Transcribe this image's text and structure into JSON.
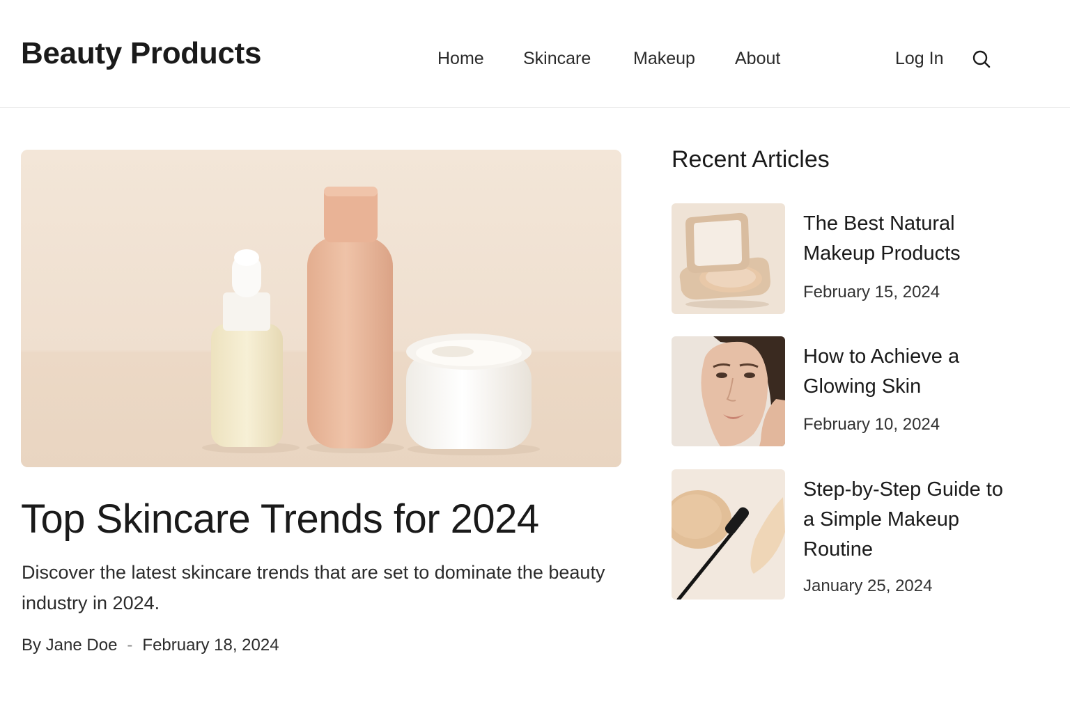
{
  "header": {
    "logo": "Beauty Products",
    "nav": [
      "Home",
      "Skincare",
      "Makeup",
      "About"
    ],
    "login": "Log In",
    "search_icon": "search-icon"
  },
  "hero": {
    "image_icon": "skincare-products-photo",
    "title": "Top Skincare Trends for 2024",
    "description": "Discover the latest skincare trends that are set to dominate the beauty industry in 2024.",
    "author": "By Jane Doe",
    "separator": "-",
    "date": "February 18, 2024"
  },
  "sidebar": {
    "heading": "Recent Articles",
    "articles": [
      {
        "title": "The Best Natural Makeup Products",
        "date": "February 15, 2024",
        "thumb": "compact-powder-photo"
      },
      {
        "title": "How to Achieve a Glowing Skin",
        "date": "February 10, 2024",
        "thumb": "woman-face-photo"
      },
      {
        "title": "Step-by-Step Guide to a Simple Makeup Routine",
        "date": "January 25, 2024",
        "thumb": "mascara-foundation-photo"
      }
    ]
  },
  "colors": {
    "background": "#ffffff",
    "text": "#1a1a1a",
    "hero_bg": "#f1e4d6",
    "bottle_peach": "#e9b89c"
  }
}
